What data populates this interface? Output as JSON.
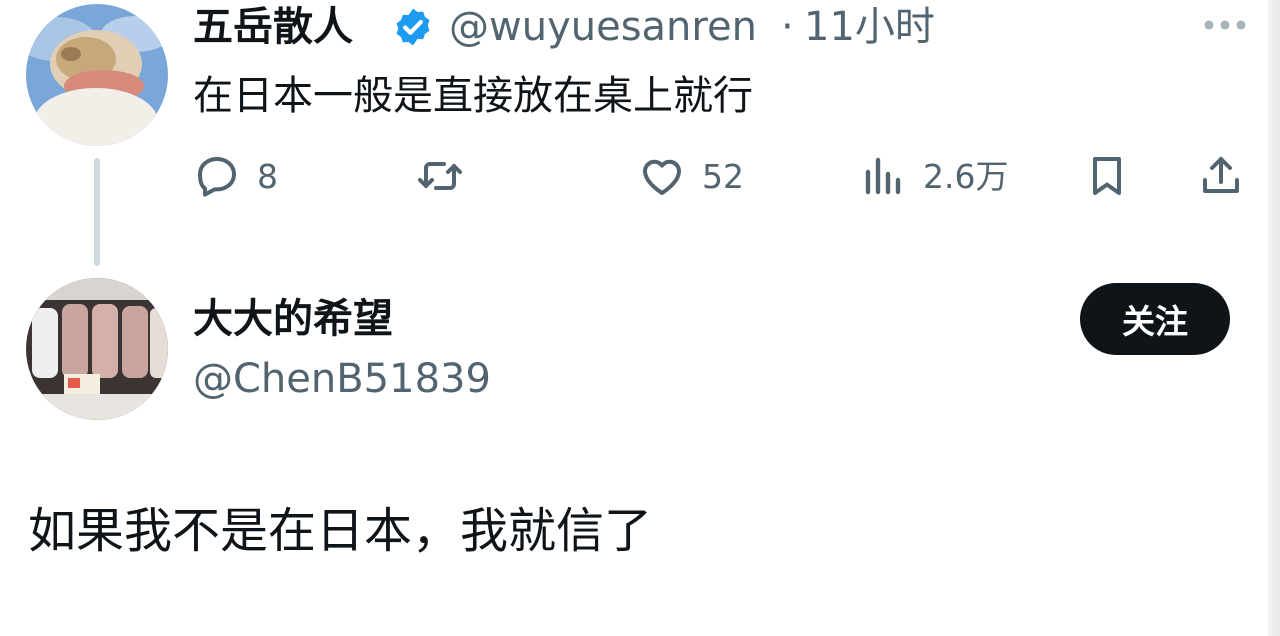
{
  "tweet1": {
    "author_name": "五岳散人",
    "handle": "@wuyuesanren",
    "separator": "·",
    "time": "11小时",
    "text": "在日本一般是直接放在桌上就行",
    "actions": {
      "replies": "8",
      "likes": "52",
      "views": "2.6万"
    },
    "icons": [
      "verified-badge-icon",
      "more-icon",
      "reply-icon",
      "retweet-icon",
      "like-icon",
      "views-icon",
      "bookmark-icon",
      "share-icon"
    ]
  },
  "tweet2": {
    "author_name": "大大的希望",
    "handle": "@ChenB51839",
    "follow_label": "关注",
    "text": "如果我不是在日本，我就信了"
  },
  "colors": {
    "text": "#0f1419",
    "secondary": "#536471",
    "verified": "#1d9bf0",
    "button_bg": "#0f1419",
    "thread_line": "#cfd9de"
  }
}
